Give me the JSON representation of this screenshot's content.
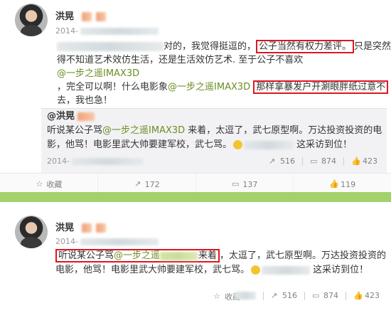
{
  "post1": {
    "author": "洪晃",
    "time_prefix": "2014-",
    "text_a": "对的，我觉得挺逗的，",
    "text_box1": "公子当然有权力差评。",
    "text_b": "只是突然觉",
    "line2": "得不知道艺术效仿生活，还是生活效仿艺术. 至于公子不喜欢",
    "link1": "@一步之遥IMAX3D",
    "line3_a": "，完全可以啊！什么电影象",
    "link2": "@一步之遥IMAX3D",
    "text_box2": "那样拿暴发户开涮眼胖纸过意不",
    "line4": "去，我也急！",
    "repost": {
      "author": "@洪晃",
      "line1_a": "听说某公子骂",
      "link": "@一步之遥IMAX3D",
      "line1_b": " 来着，太逗了，武七原型啊。万达投资投资的电",
      "line2_a": "影，他骂！电影里武大帅要建军校，武七骂。",
      "line2_b": " 这采访到位！",
      "time_prefix": "2014-",
      "forward_count": "516",
      "comment_count": "874",
      "like_count": "423"
    },
    "actions": {
      "favorite": "收藏",
      "forward": "172",
      "comment": "137",
      "like": "119"
    }
  },
  "post2": {
    "author": "洪晃",
    "time_prefix": "2014-",
    "box_a": "听说某公子骂",
    "box_link": "@一步之遥",
    "box_b": "来着",
    "line1_rest": "，太逗了，武七原型啊。万达投资投资的",
    "line2_a": "电影，他骂！电影里武大帅要建军校，武七骂。",
    "line2_b": " 这采访到位！",
    "forward_count": "516",
    "comment_count": "874",
    "like_count": "423",
    "favorite": "收藏"
  }
}
